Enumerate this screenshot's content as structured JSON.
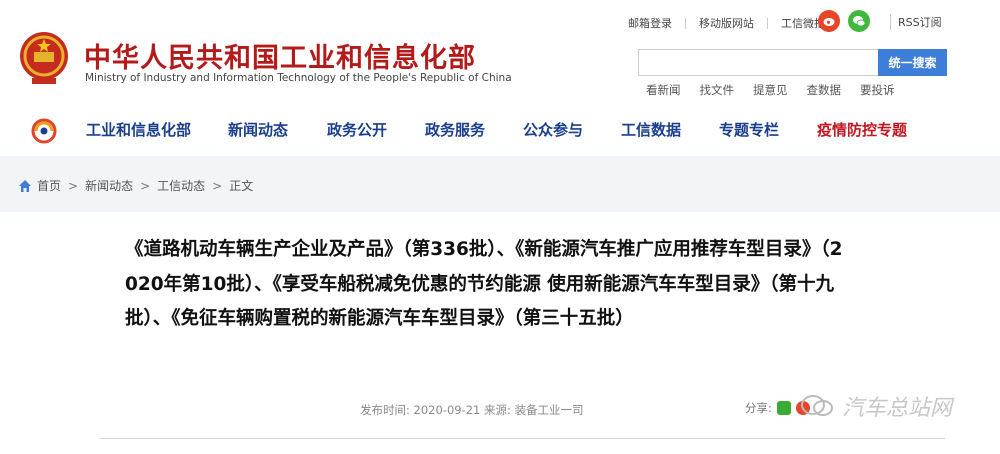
{
  "site": {
    "title": "中华人民共和国工业和信息化部",
    "subtitle": "Ministry of Industry and Information Technology of the People's Republic of China"
  },
  "top_links": [
    "邮箱登录",
    "移动版网站",
    "工信微报"
  ],
  "rss_label": "RSS订阅",
  "search": {
    "value": "",
    "placeholder": "",
    "button_label": "统一搜索"
  },
  "quick_links": [
    "看新闻",
    "找文件",
    "提意见",
    "查数据",
    "要投诉"
  ],
  "nav": {
    "items": [
      {
        "label": "工业和信息化部",
        "highlight": false
      },
      {
        "label": "新闻动态",
        "highlight": false
      },
      {
        "label": "政务公开",
        "highlight": false
      },
      {
        "label": "政务服务",
        "highlight": false
      },
      {
        "label": "公众参与",
        "highlight": false
      },
      {
        "label": "工信数据",
        "highlight": false
      },
      {
        "label": "专题专栏",
        "highlight": false
      },
      {
        "label": "疫情防控专题",
        "highlight": true
      }
    ]
  },
  "breadcrumb": [
    "首页",
    "新闻动态",
    "工信动态",
    "正文"
  ],
  "article": {
    "title": "《道路机动车辆生产企业及产品》（第336批）、《新能源汽车推广应用推荐车型目录》（2020年第10批）、《享受车船税减免优惠的节约能源 使用新能源汽车车型目录》（第十九批）、《免征车辆购置税的新能源汽车车型目录》（第三十五批）",
    "publish_label": "发布时间:",
    "publish_date": "2020-09-21",
    "source_label": "来源:",
    "source": "装备工业一司",
    "share_label": "分享:"
  },
  "watermark": "汽车总站网",
  "colors": {
    "title_red": "#b31b1b",
    "nav_blue": "#1a3f8c",
    "nav_highlight_red": "#c01921",
    "search_button_blue": "#3d7ed8",
    "breadcrumb_band": "#f2f4f8"
  },
  "icons": [
    "national-emblem-icon",
    "weibo-icon",
    "wechat-icon",
    "miit-logo-icon",
    "home-icon",
    "wechat-share-icon",
    "weibo-share-icon",
    "watermark-logo-icon"
  ]
}
